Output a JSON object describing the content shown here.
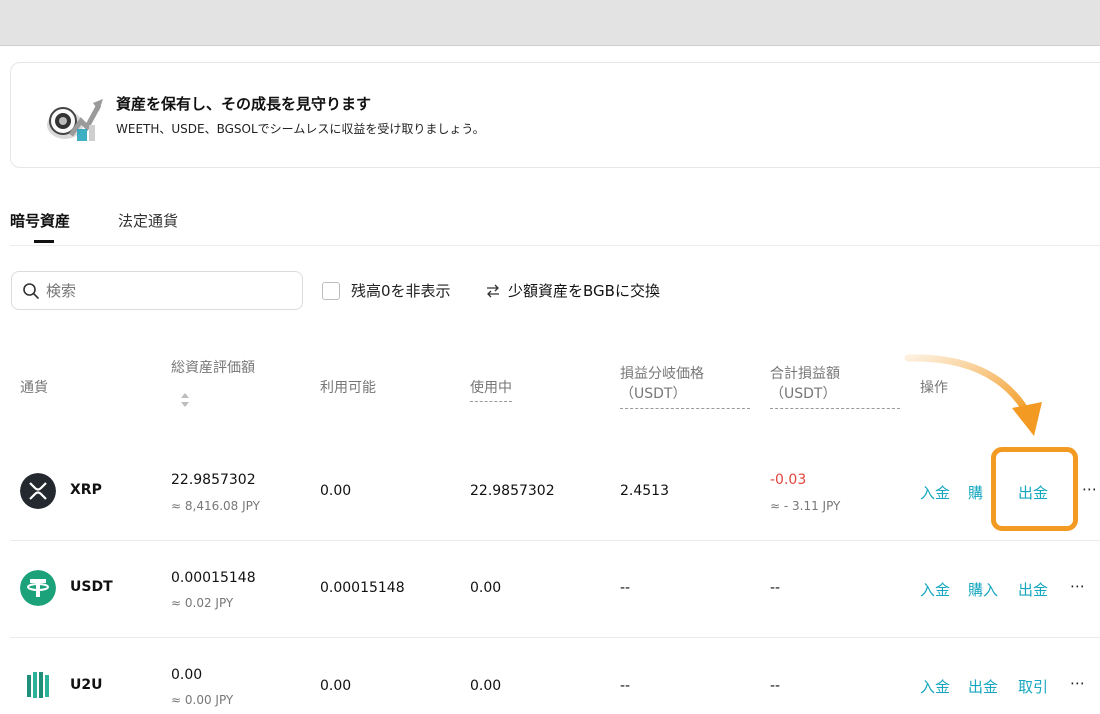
{
  "banner": {
    "title": "資産を保有し、その成長を見守ります",
    "subtitle": "WEETH、USDE、BGSOLでシームレスに収益を受け取りましょう。"
  },
  "tabs": [
    {
      "label": "暗号資産"
    },
    {
      "label": "法定通貨"
    }
  ],
  "search": {
    "placeholder": "検索",
    "value": ""
  },
  "filters": {
    "hide_zero_label": "残高0を非表示",
    "convert_label": "少額資産をBGBに交換"
  },
  "table": {
    "headers": {
      "currency": "通貨",
      "total_valuation": "総資産評価額",
      "available": "利用可能",
      "in_use": "使用中",
      "breakeven_line1": "損益分岐価格",
      "breakeven_line2": "（USDT）",
      "total_pnl_line1": "合計損益額",
      "total_pnl_line2": "（USDT）",
      "actions": "操作"
    },
    "rows": [
      {
        "symbol": "XRP",
        "total": "22.9857302",
        "total_jpy": "≈ 8,416.08 JPY",
        "available": "0.00",
        "in_use": "22.9857302",
        "breakeven": "2.4513",
        "pnl": "-0.03",
        "pnl_jpy": "≈ - 3.11 JPY",
        "actions": [
          "入金",
          "購",
          "出金"
        ],
        "more": "⋯"
      },
      {
        "symbol": "USDT",
        "total": "0.00015148",
        "total_jpy": "≈ 0.02 JPY",
        "available": "0.00015148",
        "in_use": "0.00",
        "breakeven": "--",
        "pnl": "--",
        "actions": [
          "入金",
          "購入",
          "出金"
        ],
        "more": "⋯"
      },
      {
        "symbol": "U2U",
        "total": "0.00",
        "total_jpy": "≈ 0.00 JPY",
        "available": "0.00",
        "in_use": "0.00",
        "breakeven": "--",
        "pnl": "--",
        "actions": [
          "入金",
          "出金",
          "取引"
        ],
        "more": "⋯"
      }
    ]
  },
  "colors": {
    "accent": "#18a7c0",
    "negative": "#e2453c",
    "annotation": "#f29a22"
  },
  "icons": [
    "search-icon",
    "swap-arrows-icon",
    "sort-icon",
    "xrp-logo-icon",
    "usdt-logo-icon",
    "u2u-logo-icon",
    "curved-arrow-icon"
  ]
}
